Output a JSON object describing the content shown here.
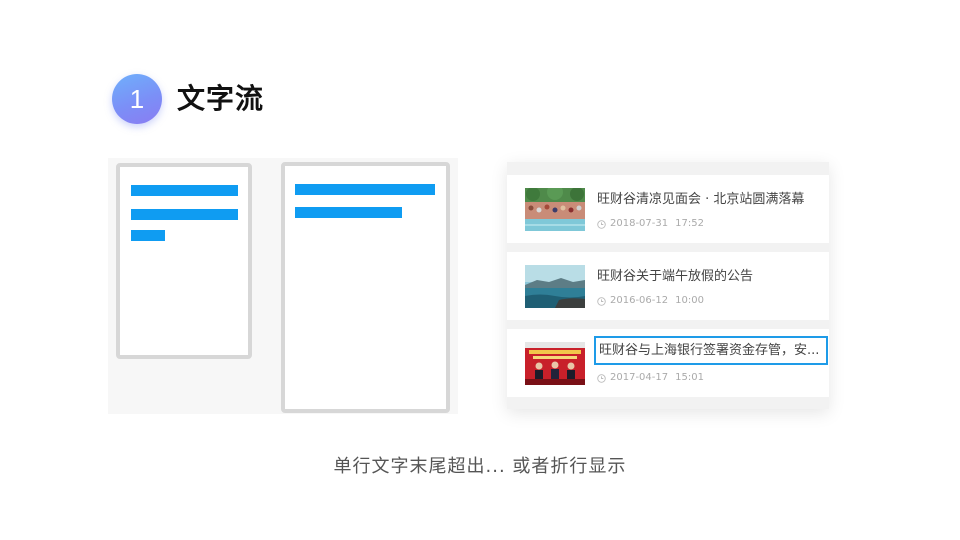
{
  "header": {
    "step_number": "1",
    "title": "文字流"
  },
  "colors": {
    "accent": "#0f9cf2",
    "highlight_border": "#1e9be8",
    "wireframe_border": "#d7d7d7"
  },
  "news_list": {
    "items": [
      {
        "title": "旺财谷清凉见面会 · 北京站圆满落幕",
        "date": "2018-07-31",
        "time": "17:52",
        "thumbnail": "crowd-pool-photo"
      },
      {
        "title": "旺财谷关于端午放假的公告",
        "date": "2016-06-12",
        "time": "10:00",
        "thumbnail": "sea-landscape-photo"
      },
      {
        "title": "旺财谷与上海银行签署资金存管，安...",
        "date": "2017-04-17",
        "time": "15:01",
        "thumbnail": "signing-ceremony-photo"
      }
    ]
  },
  "caption": "单行文字末尾超出... 或者折行显示"
}
